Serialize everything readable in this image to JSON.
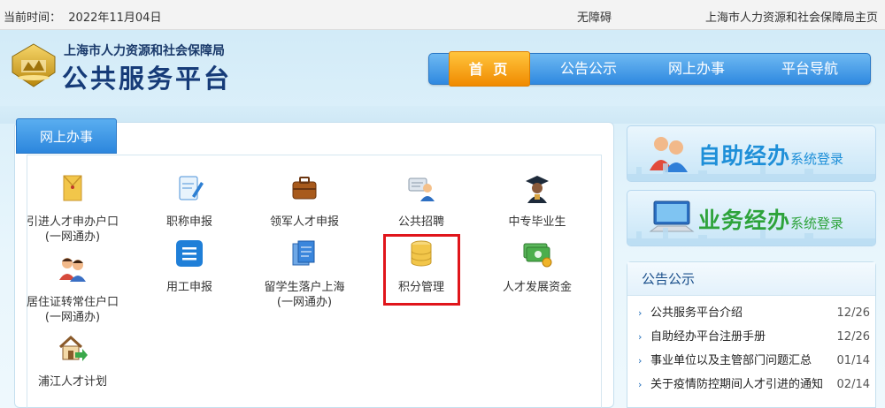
{
  "topbar": {
    "date_label": "当前时间：",
    "date_value": "2022年11月04日",
    "accessibility": "无障碍",
    "home_link": "上海市人力资源和社会保障局主页"
  },
  "header": {
    "org_name": "上海市人力资源和社会保障局",
    "platform_name": "公共服务平台"
  },
  "nav": {
    "items": [
      {
        "label": "首 页",
        "active": true
      },
      {
        "label": "公告公示"
      },
      {
        "label": "网上办事"
      },
      {
        "label": "平台导航"
      }
    ]
  },
  "panel": {
    "tab_label": "网上办事",
    "tiles": [
      {
        "label": "引进人才申办户口",
        "sub": "(一网通办)",
        "icon": "document-envelope-icon"
      },
      {
        "label": "职称申报",
        "sub": "",
        "icon": "certificate-pen-icon"
      },
      {
        "label": "领军人才申报",
        "sub": "",
        "icon": "briefcase-icon"
      },
      {
        "label": "公共招聘",
        "sub": "",
        "icon": "recruit-person-icon"
      },
      {
        "label": "中专毕业生",
        "sub": "",
        "icon": "graduate-icon"
      },
      {
        "label": "居住证转常住户口",
        "sub": "(一网通办)",
        "icon": "couple-icon"
      },
      {
        "label": "用工申报",
        "sub": "",
        "icon": "list-icon"
      },
      {
        "label": "留学生落户上海",
        "sub": "(一网通办)",
        "icon": "documents-icon"
      },
      {
        "label": "积分管理",
        "sub": "",
        "icon": "database-icon"
      },
      {
        "label": "人才发展资金",
        "sub": "",
        "icon": "money-icon"
      },
      {
        "label": "浦江人才计划",
        "sub": "",
        "icon": "house-arrow-icon"
      }
    ]
  },
  "promos": [
    {
      "big": "自助经办",
      "small": "系统登录"
    },
    {
      "big": "业务经办",
      "small": "系统登录"
    }
  ],
  "notices": {
    "title": "公告公示",
    "items": [
      {
        "title": "公共服务平台介绍",
        "date": "12/26"
      },
      {
        "title": "自助经办平台注册手册",
        "date": "12/26"
      },
      {
        "title": "事业单位以及主管部门问题汇总",
        "date": "01/14"
      },
      {
        "title": "关于疫情防控期间人才引进的通知",
        "date": "02/14"
      }
    ]
  },
  "colors": {
    "nav_blue": "#2f89e0",
    "nav_active_orange": "#f08a00",
    "highlight_red": "#e0151b",
    "title_navy": "#163b78"
  }
}
